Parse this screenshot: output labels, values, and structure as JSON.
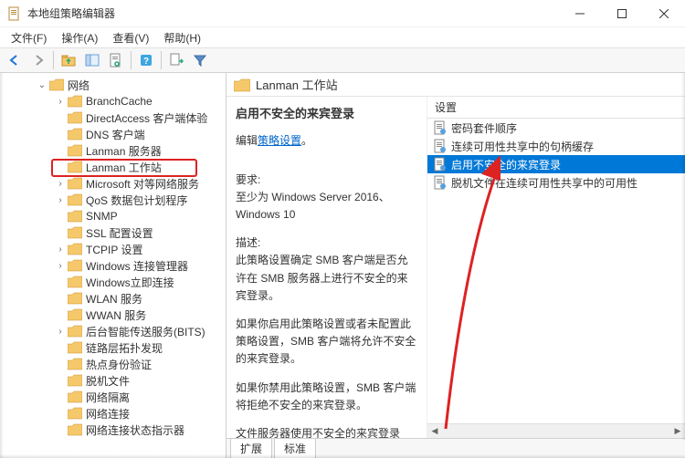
{
  "window": {
    "title": "本地组策略编辑器"
  },
  "menu": {
    "file": "文件(F)",
    "action": "操作(A)",
    "view": "查看(V)",
    "help": "帮助(H)"
  },
  "tree": {
    "parent": "网络",
    "items": [
      "BranchCache",
      "DirectAccess 客户端体验",
      "DNS 客户端",
      "Lanman 服务器",
      "Lanman 工作站",
      "Microsoft 对等网络服务",
      "QoS 数据包计划程序",
      "SNMP",
      "SSL 配置设置",
      "TCPIP 设置",
      "Windows 连接管理器",
      "Windows立即连接",
      "WLAN 服务",
      "WWAN 服务",
      "后台智能传送服务(BITS)",
      "链路层拓扑发现",
      "热点身份验证",
      "脱机文件",
      "网络隔离",
      "网络连接",
      "网络连接状态指示器"
    ]
  },
  "right": {
    "header": "Lanman 工作站",
    "setting_title": "启用不安全的来宾登录",
    "edit_label": "编辑",
    "edit_link": "策略设置",
    "req_label": "要求:",
    "req_text": "至少为 Windows Server 2016、Windows 10",
    "desc_label": "描述:",
    "desc_p1": "此策略设置确定 SMB 客户端是否允许在 SMB 服务器上进行不安全的来宾登录。",
    "desc_p2": "如果你启用此策略设置或者未配置此策略设置，SMB 客户端将允许不安全的来宾登录。",
    "desc_p3": "如果你禁用此策略设置，SMB 客户端将拒绝不安全的来宾登录。",
    "desc_p4": "文件服务器使用不安全的来宾登录",
    "col_header": "设置",
    "list": [
      "密码套件顺序",
      "连续可用性共享中的句柄缓存",
      "启用不安全的来宾登录",
      "脱机文件在连续可用性共享中的可用性"
    ],
    "tabs": {
      "ext": "扩展",
      "std": "标准"
    }
  }
}
